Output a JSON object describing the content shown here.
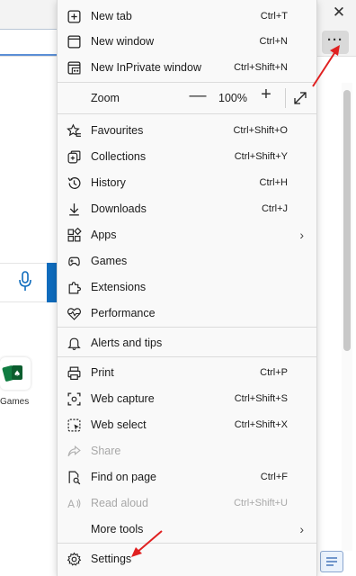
{
  "background": {
    "close_glyph": "✕",
    "more_glyph": "···",
    "games_label": "Games"
  },
  "menu": {
    "items_top": [
      {
        "icon": "new-tab-icon",
        "label": "New tab",
        "shortcut": "Ctrl+T"
      },
      {
        "icon": "new-window-icon",
        "label": "New window",
        "shortcut": "Ctrl+N"
      },
      {
        "icon": "inprivate-window-icon",
        "label": "New InPrivate window",
        "shortcut": "Ctrl+Shift+N"
      }
    ],
    "zoom": {
      "label": "Zoom",
      "minus": "—",
      "value": "100%",
      "plus": "+"
    },
    "items_mid": [
      {
        "icon": "favourites-icon",
        "label": "Favourites",
        "shortcut": "Ctrl+Shift+O"
      },
      {
        "icon": "collections-icon",
        "label": "Collections",
        "shortcut": "Ctrl+Shift+Y"
      },
      {
        "icon": "history-icon",
        "label": "History",
        "shortcut": "Ctrl+H"
      },
      {
        "icon": "downloads-icon",
        "label": "Downloads",
        "shortcut": "Ctrl+J"
      },
      {
        "icon": "apps-icon",
        "label": "Apps",
        "shortcut": ""
      },
      {
        "icon": "games-icon",
        "label": "Games",
        "shortcut": ""
      },
      {
        "icon": "extensions-icon",
        "label": "Extensions",
        "shortcut": ""
      },
      {
        "icon": "performance-icon",
        "label": "Performance",
        "shortcut": ""
      }
    ],
    "alerts": {
      "icon": "bell-icon",
      "label": "Alerts and tips"
    },
    "items_tools": [
      {
        "icon": "print-icon",
        "label": "Print",
        "shortcut": "Ctrl+P"
      },
      {
        "icon": "web-capture-icon",
        "label": "Web capture",
        "shortcut": "Ctrl+Shift+S"
      },
      {
        "icon": "web-select-icon",
        "label": "Web select",
        "shortcut": "Ctrl+Shift+X"
      },
      {
        "icon": "share-icon",
        "label": "Share",
        "shortcut": ""
      },
      {
        "icon": "find-on-page-icon",
        "label": "Find on page",
        "shortcut": "Ctrl+F"
      },
      {
        "icon": "read-aloud-icon",
        "label": "Read aloud",
        "shortcut": "Ctrl+Shift+U"
      },
      {
        "icon": "",
        "label": "More tools",
        "shortcut": ""
      }
    ],
    "settings": {
      "icon": "settings-icon",
      "label": "Settings"
    },
    "chevron": "›"
  },
  "colors": {
    "annotation_arrow": "#e02020",
    "accent": "#0f6cbd"
  }
}
